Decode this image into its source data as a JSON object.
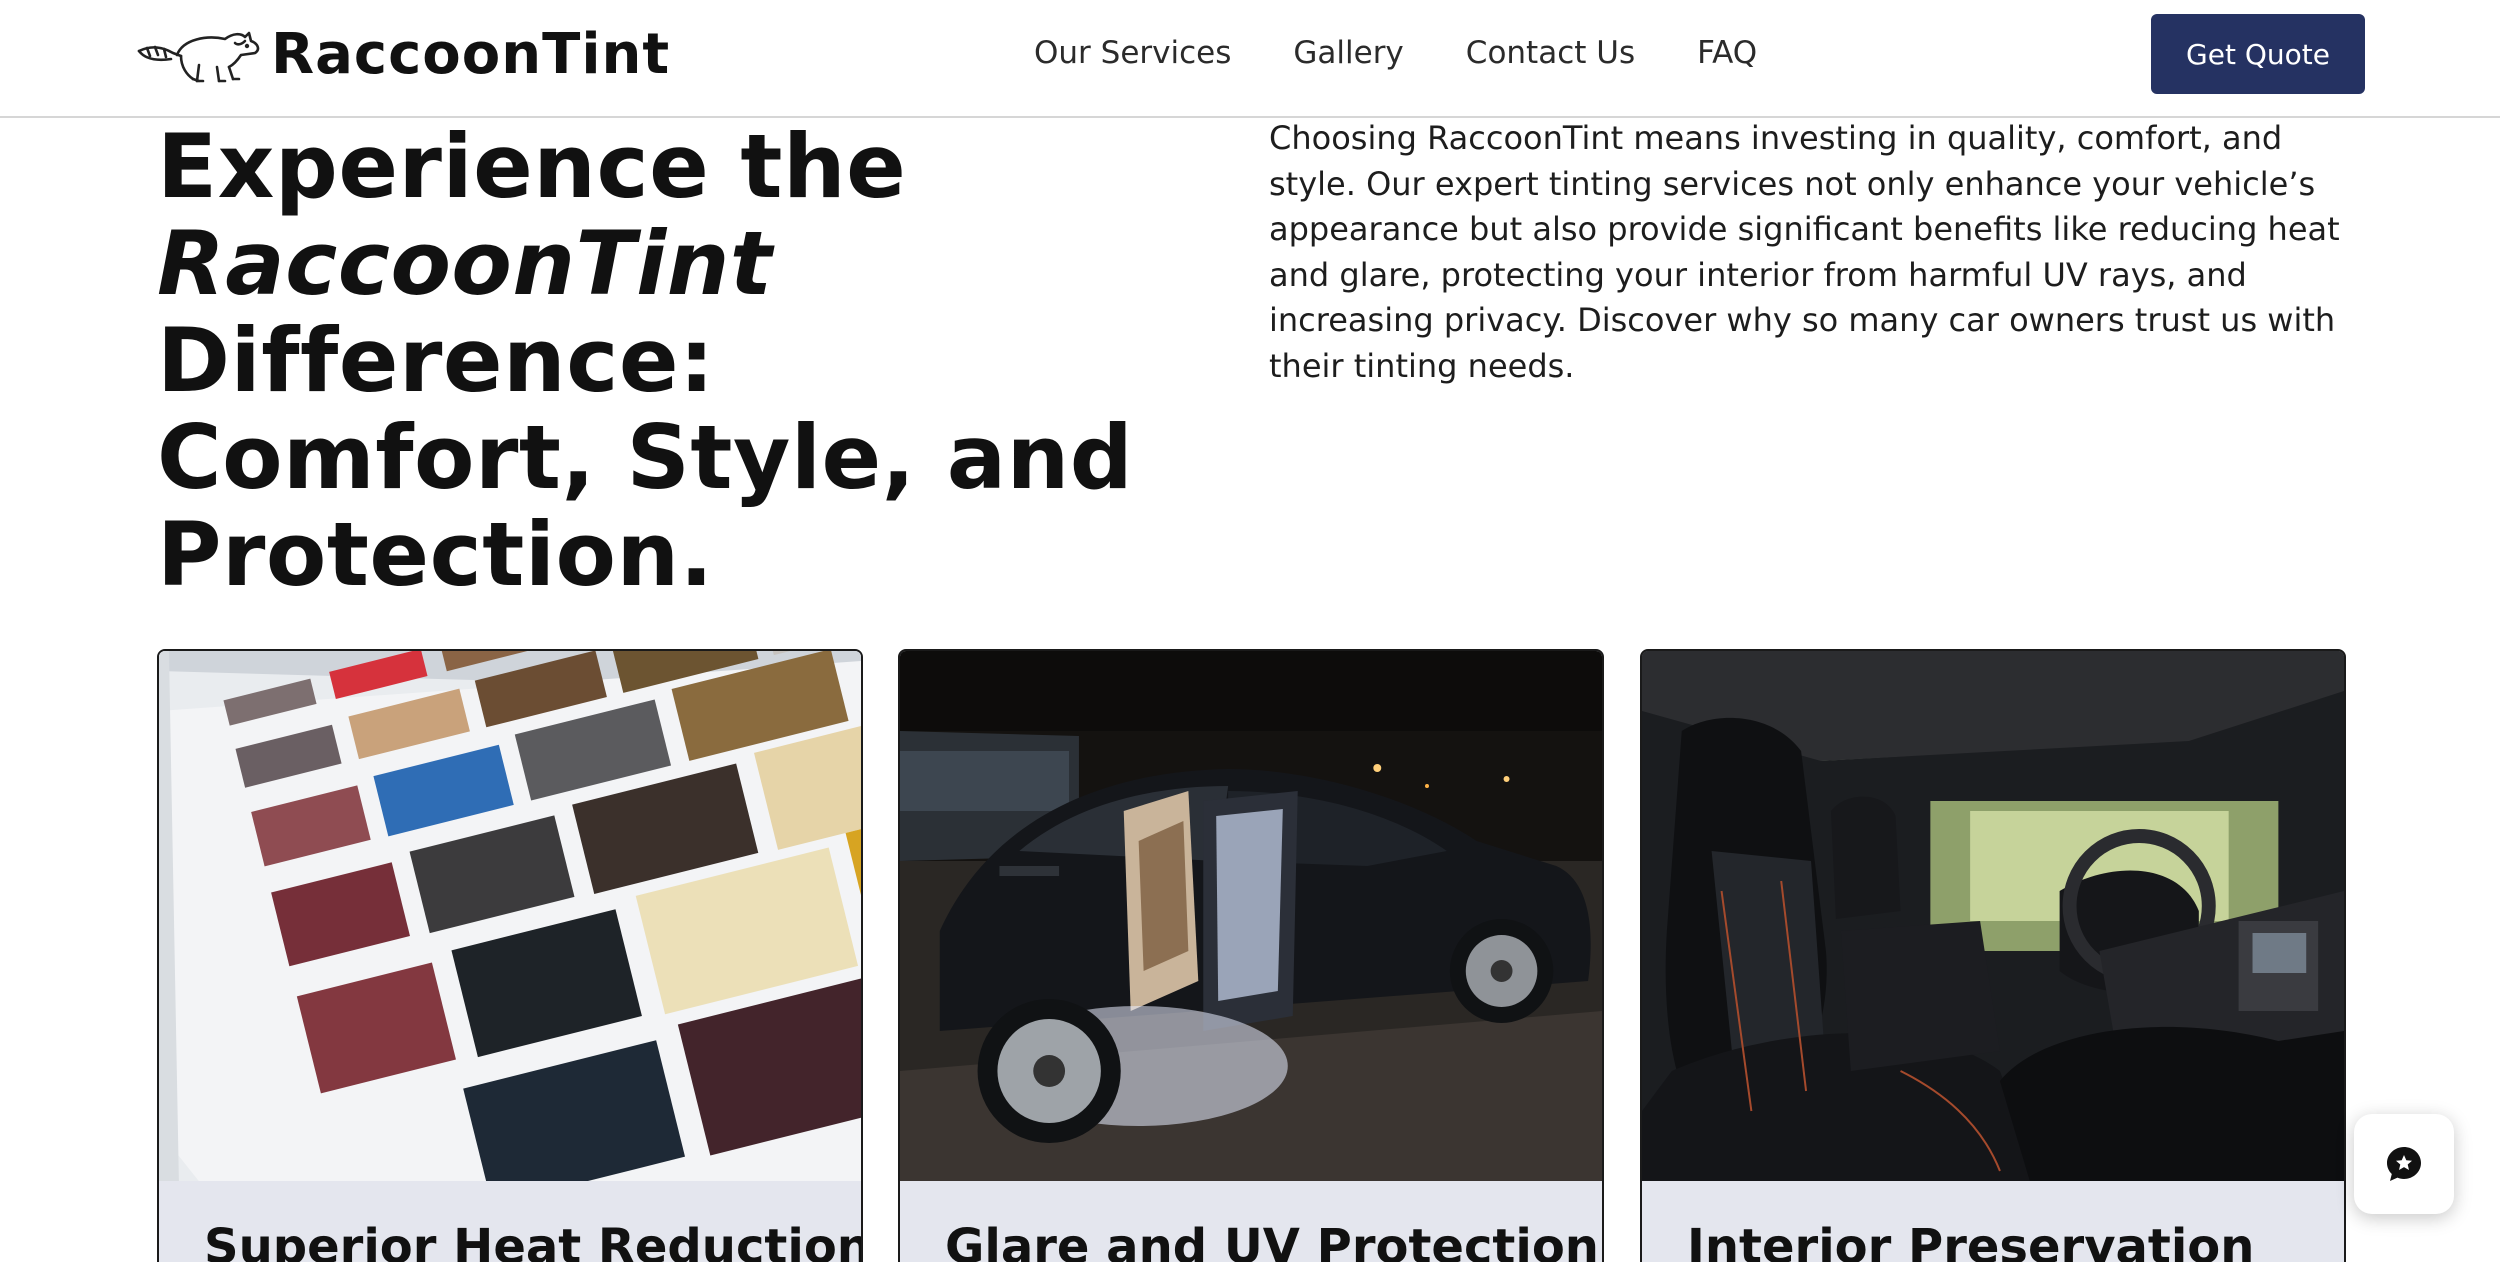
{
  "header": {
    "logo_text": "RaccoonTint",
    "nav": [
      {
        "label": "Our Services"
      },
      {
        "label": "Gallery"
      },
      {
        "label": "Contact Us"
      },
      {
        "label": "FAQ"
      }
    ],
    "cta_label": "Get Quote",
    "cta_color": "#253262"
  },
  "hero": {
    "title_line1": "Experience the",
    "title_brand": "RaccoonTint",
    "title_rest_line2": " Difference:",
    "title_line3": "Comfort, Style, and",
    "title_line4": "Protection.",
    "description": "Choosing RaccoonTint means investing in quality, comfort, and style. Our expert tinting services not only enhance your vehicle’s appearance but also provide significant benefits like reducing heat and glare, protecting your interior from harmful UV rays, and increasing privacy. Discover why so many car owners trust us with their tinting needs."
  },
  "cards": [
    {
      "title": "Superior Heat Reduction",
      "image": "tint-film-swatches-photo"
    },
    {
      "title": "Glare and UV Protection",
      "image": "sedan-open-door-night-photo"
    },
    {
      "title": "Interior Preservation",
      "image": "leather-car-interior-photo"
    }
  ],
  "chat": {
    "icon": "chat-bubble-icon"
  }
}
